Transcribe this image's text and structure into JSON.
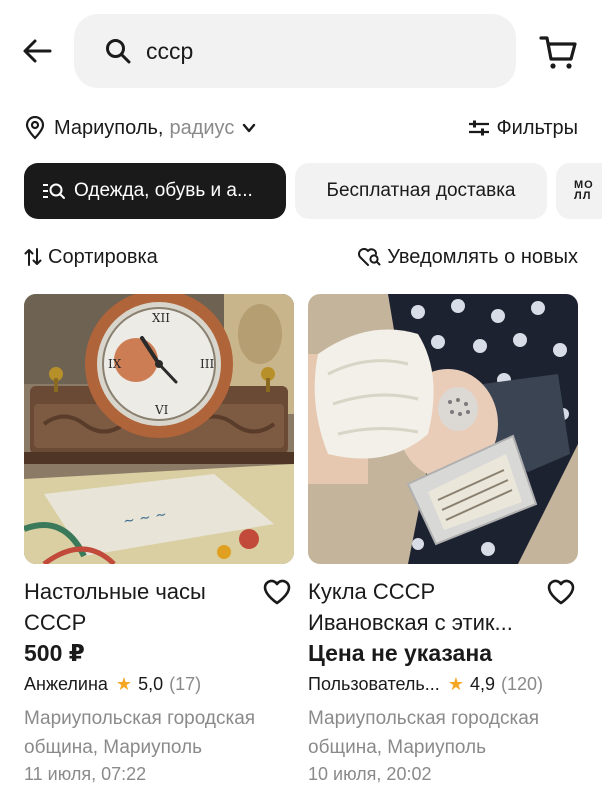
{
  "header": {
    "search_value": "ссср"
  },
  "location": {
    "city": "Мариуполь,",
    "radius_label": "радиус"
  },
  "filters_label": "Фильтры",
  "chips": {
    "category": "Одежда, обувь и а...",
    "free_delivery": "Бесплатная доставка",
    "partial_line1": "МО",
    "partial_line2": "ЛЛ"
  },
  "sort_label": "Сортировка",
  "notify_label": "Уведомлять о новых",
  "listings": [
    {
      "title": "Настольные часы СССР",
      "price": "500 ₽",
      "seller": "Анжелина",
      "rating": "5,0",
      "reviews": "(17)",
      "address": "Мариупольская городская община, Мариуполь",
      "date": "11 июля, 07:22"
    },
    {
      "title": "Кукла СССР Ивановская с этик...",
      "price": "Цена не указана",
      "seller": "Пользователь...",
      "rating": "4,9",
      "reviews": "(120)",
      "address": "Мариупольская городская община, Мариуполь",
      "date": "10 июля, 20:02"
    }
  ],
  "colors": {
    "text": "#1a1a1a",
    "muted": "#8a8a8a",
    "chip_bg": "#f2f2f2",
    "chip_active_bg": "#1a1a1a",
    "star": "#f5a623"
  }
}
